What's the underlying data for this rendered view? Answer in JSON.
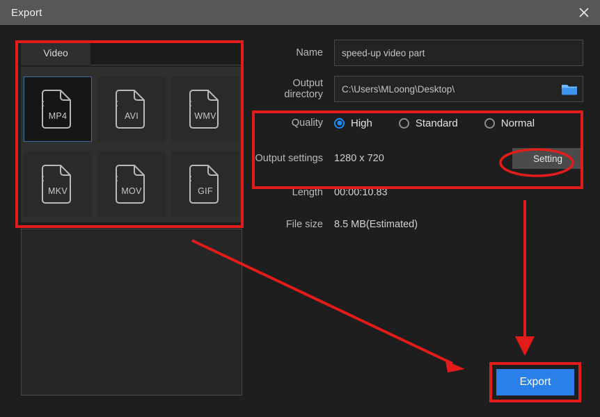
{
  "window": {
    "title": "Export",
    "close_icon": "close-icon"
  },
  "left_panel": {
    "tabs": [
      {
        "label": "Video",
        "active": true
      }
    ],
    "formats": [
      {
        "label": "MP4",
        "selected": true
      },
      {
        "label": "AVI",
        "selected": false
      },
      {
        "label": "WMV",
        "selected": false
      },
      {
        "label": "MKV",
        "selected": false
      },
      {
        "label": "MOV",
        "selected": false
      },
      {
        "label": "GIF",
        "selected": false
      }
    ]
  },
  "form": {
    "name": {
      "label": "Name",
      "value": "speed-up video part",
      "placeholder": "speed-up video part"
    },
    "output_directory": {
      "label": "Output directory",
      "value": "C:\\Users\\MLoong\\Desktop\\",
      "placeholder": "C:\\Users\\MLoong\\Desktop\\",
      "browse_icon": "folder-icon"
    },
    "quality": {
      "label": "Quality",
      "selected": "High",
      "options": [
        {
          "label": "High",
          "selected": true
        },
        {
          "label": "Standard",
          "selected": false
        },
        {
          "label": "Normal",
          "selected": false
        }
      ]
    },
    "output_settings": {
      "label": "Output settings",
      "value": "1280 x 720",
      "button_label": "Setting"
    },
    "length": {
      "label": "Length",
      "value": "00:00:10.83"
    },
    "file_size": {
      "label": "File size",
      "value": "8.5 MB(Estimated)"
    }
  },
  "actions": {
    "export_label": "Export"
  },
  "colors": {
    "accent_blue": "#2a7fe8",
    "radio_blue": "#1a8cff",
    "annotation_red": "#e21b1b",
    "titlebar": "#575757",
    "window_bg": "#1e1e1e"
  },
  "annotations": {
    "highlight_formats": "red-rectangle-around-format-tiles",
    "highlight_quality": "red-rectangle-around-quality-and-output-settings",
    "highlight_setting": "red-ellipse-around-setting-button",
    "highlight_export": "red-rectangle-around-export-button",
    "arrow_diagonal": "red-arrow-pointing-to-export-button",
    "arrow_vertical": "red-arrow-from-settings-to-export-button"
  }
}
